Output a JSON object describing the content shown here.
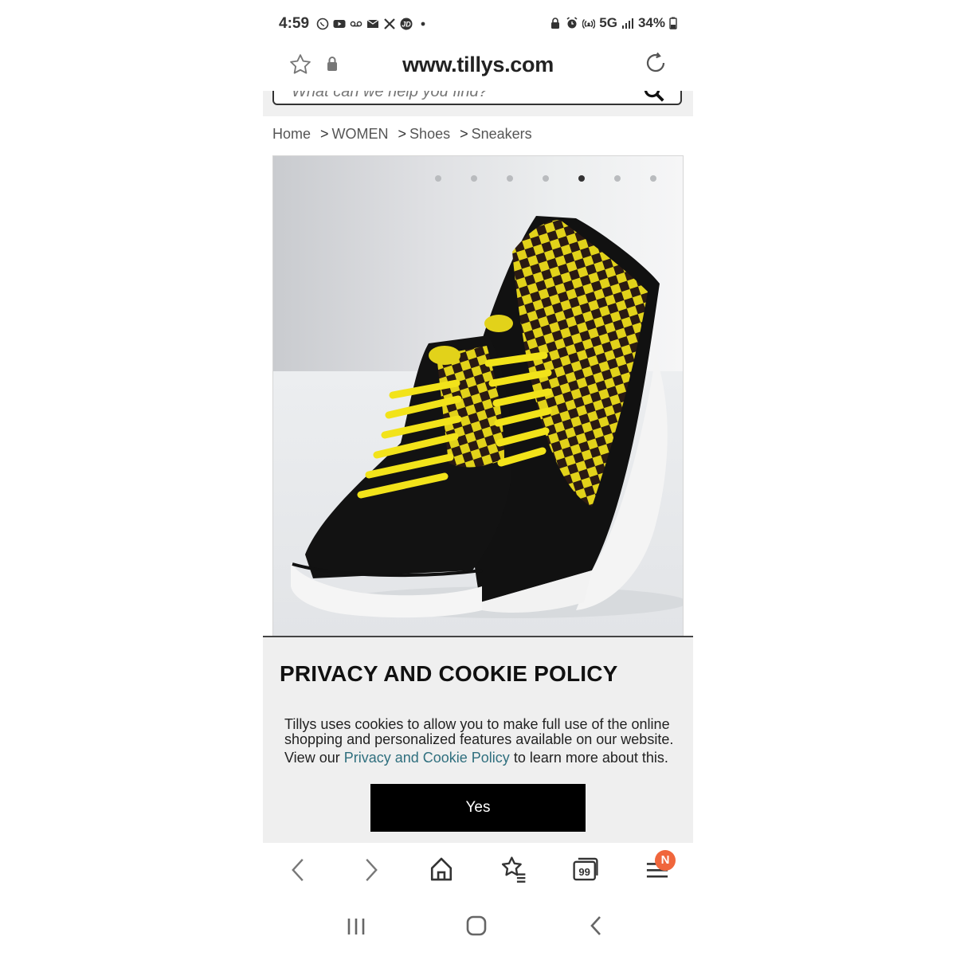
{
  "status_bar": {
    "time": "4:59",
    "network": "5G",
    "battery": "34%"
  },
  "browser": {
    "url": "www.tillys.com"
  },
  "search": {
    "placeholder": "What can we help you find?"
  },
  "breadcrumb": {
    "items": [
      "Home",
      "WOMEN",
      "Shoes",
      "Sneakers"
    ],
    "separator": ">"
  },
  "carousel": {
    "dot_count": 7,
    "active_index": 4
  },
  "cookie_modal": {
    "title": "PRIVACY AND COOKIE POLICY",
    "text_line1": "Tillys uses cookies to allow you to make full use of the online shopping and personalized features available on our website.",
    "text_before_link": "View our ",
    "link_text": "Privacy and Cookie Policy",
    "text_after_link": " to learn more about this.",
    "yes_label": "Yes"
  },
  "toolbar": {
    "menu_badge": "N"
  },
  "colors": {
    "accent_link": "#2f6f7e",
    "badge": "#f0663c",
    "button_bg": "#000000"
  }
}
